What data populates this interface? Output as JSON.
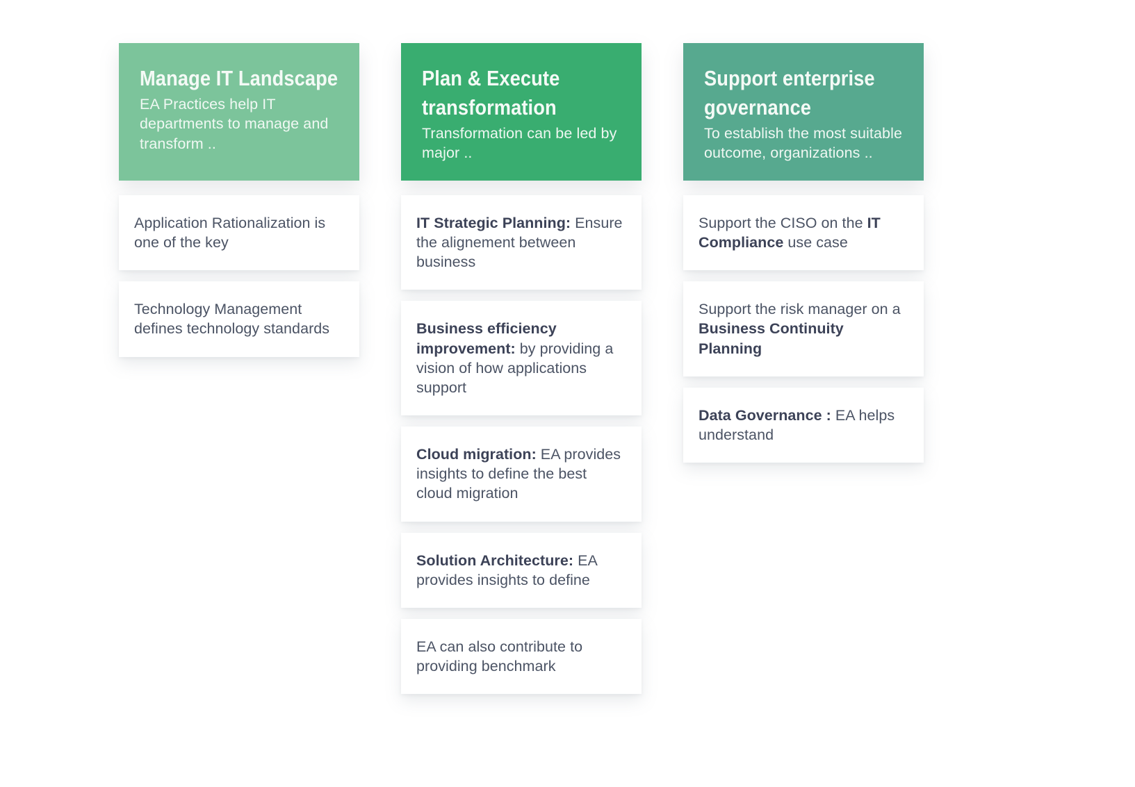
{
  "colors": {
    "column1_header_bg": "#7cc49b",
    "column2_header_bg": "#39ad70",
    "column3_header_bg": "#57a98f",
    "card_bg": "#ffffff",
    "body_text": "#4b5364",
    "bold_text": "#3c4257",
    "header_text": "#f4faf6",
    "page_bg": "#ffffff"
  },
  "columns": [
    {
      "id": "manage-it-landscape",
      "header": {
        "title": "Manage IT Landscape",
        "subtitle": "EA Practices help IT departments to manage and transform .."
      },
      "cards": [
        {
          "lead": "",
          "text": "Application Rationalization is one of the key"
        },
        {
          "lead": "",
          "text": "Technology Management defines technology standards"
        }
      ]
    },
    {
      "id": "plan-execute-transformation",
      "header": {
        "title": "Plan & Execute transformation",
        "subtitle": "Transformation can be led by major .."
      },
      "cards": [
        {
          "lead": "IT Strategic Planning:",
          "text": " Ensure the alignement between business"
        },
        {
          "lead": "Business efficiency improvement:",
          "text": " by providing a vision of how applications support"
        },
        {
          "lead": "Cloud migration:",
          "text": " EA provides insights to define the best cloud migration"
        },
        {
          "lead": "Solution Architecture:",
          "text": " EA provides insights to define"
        },
        {
          "lead": "",
          "text": "EA can also contribute to providing benchmark"
        }
      ]
    },
    {
      "id": "support-enterprise-governance",
      "header": {
        "title": "Support enterprise governance",
        "subtitle": "To establish the most suitable outcome, organizations .."
      },
      "cards": [
        {
          "pre": "Support the CISO on the ",
          "lead": "IT Compliance",
          "text": " use case"
        },
        {
          "pre": "Support the risk manager on a ",
          "lead": "Business Continuity Planning",
          "text": ""
        },
        {
          "pre": "",
          "lead": "Data Governance :",
          "text": " EA helps understand"
        }
      ]
    }
  ]
}
